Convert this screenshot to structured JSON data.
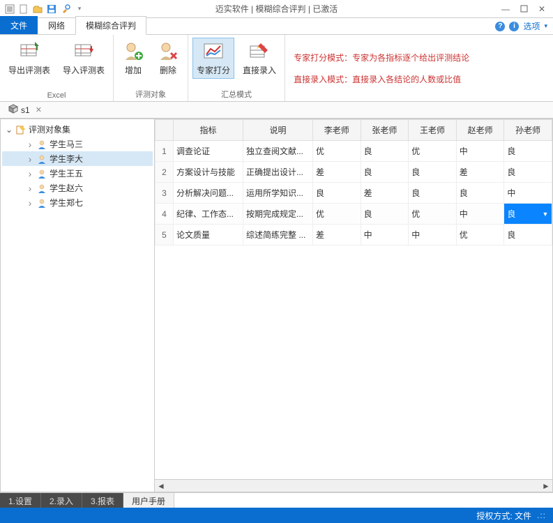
{
  "window": {
    "title": "迈实软件 | 模糊综合评判 | 已激活"
  },
  "toolbar_icons": {
    "new": "new",
    "open": "open",
    "save": "save",
    "tools": "tools"
  },
  "tabs": {
    "file": "文件",
    "network": "网络",
    "fuzzy": "模糊综合评判",
    "options": "选项"
  },
  "ribbon": {
    "excel_group": "Excel",
    "export_table": "导出评测表",
    "import_table": "导入评测表",
    "eval_target_group": "评测对象",
    "add": "增加",
    "delete": "删除",
    "summary_group": "汇总模式",
    "expert_score": "专家打分",
    "direct_input": "直接录入",
    "info1": "专家打分模式：专家为各指标逐个给出评测结论",
    "info2": "直接录入模式：直接录入各结论的人数或比值"
  },
  "subtab": {
    "label": "s1"
  },
  "tree": {
    "root": "评测对象集",
    "items": [
      {
        "label": "学生马三"
      },
      {
        "label": "学生李大"
      },
      {
        "label": "学生王五"
      },
      {
        "label": "学生赵六"
      },
      {
        "label": "学生郑七"
      }
    ],
    "selected_index": 1
  },
  "grid": {
    "headers": [
      "",
      "指标",
      "说明",
      "李老师",
      "张老师",
      "王老师",
      "赵老师",
      "孙老师"
    ],
    "rows": [
      {
        "n": "1",
        "cells": [
          "调查论证",
          "独立查阅文献...",
          "优",
          "良",
          "优",
          "中",
          "良"
        ]
      },
      {
        "n": "2",
        "cells": [
          "方案设计与技能",
          "正确提出设计...",
          "差",
          "良",
          "良",
          "差",
          "良"
        ]
      },
      {
        "n": "3",
        "cells": [
          "分析解决问题...",
          "运用所学知识...",
          "良",
          "差",
          "良",
          "良",
          "中"
        ]
      },
      {
        "n": "4",
        "cells": [
          "纪律、工作态...",
          "按期完成规定...",
          "优",
          "良",
          "优",
          "中",
          "良"
        ]
      },
      {
        "n": "5",
        "cells": [
          "论文质量",
          "综述简练完整 ...",
          "差",
          "中",
          "中",
          "优",
          "良"
        ]
      }
    ],
    "editing_cell": {
      "row": 3,
      "col": 6,
      "value": "良"
    }
  },
  "bottom_tabs": {
    "settings": "1.设置",
    "input": "2.录入",
    "report": "3.报表",
    "manual": "用户手册"
  },
  "statusbar": {
    "auth_mode": "授权方式: 文件"
  }
}
